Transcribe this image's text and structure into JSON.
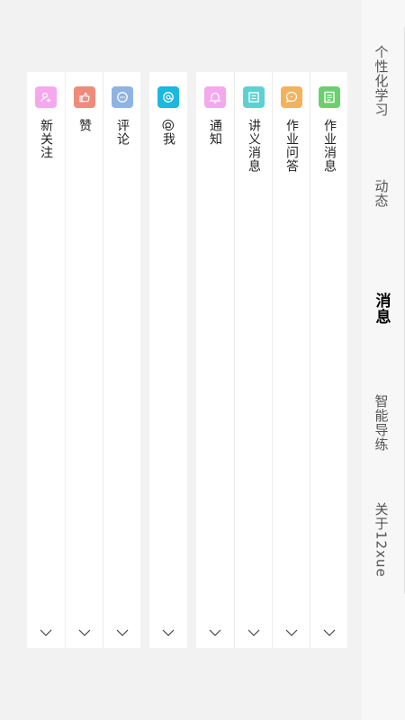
{
  "nav": {
    "items": [
      {
        "label": "个性化学习",
        "active": false
      },
      {
        "label": "动态",
        "active": false
      },
      {
        "label": "消息",
        "active": true
      },
      {
        "label": "智能导练",
        "active": false
      },
      {
        "label": "关于12xue",
        "active": false
      }
    ]
  },
  "cards": {
    "homework": {
      "items": [
        {
          "label": "作业消息",
          "icon": "document-icon",
          "color": "#6ccf6f"
        },
        {
          "label": "作业问答",
          "icon": "chat-bubble-icon",
          "color": "#f3b25c"
        },
        {
          "label": "讲义消息",
          "icon": "notes-icon",
          "color": "#5fd0d2"
        },
        {
          "label": "通知",
          "icon": "bell-icon",
          "color": "#f5a8ee"
        }
      ]
    },
    "mention": {
      "items": [
        {
          "label": "@我",
          "icon": "at-icon",
          "color": "#1db7df"
        }
      ]
    },
    "social": {
      "items": [
        {
          "label": "评论",
          "icon": "comment-icon",
          "color": "#8fb3e3"
        },
        {
          "label": "赞",
          "icon": "thumbs-up-icon",
          "color": "#f08a7b"
        },
        {
          "label": "新关注",
          "icon": "follow-user-icon",
          "color": "#f5a8ee"
        }
      ]
    }
  }
}
